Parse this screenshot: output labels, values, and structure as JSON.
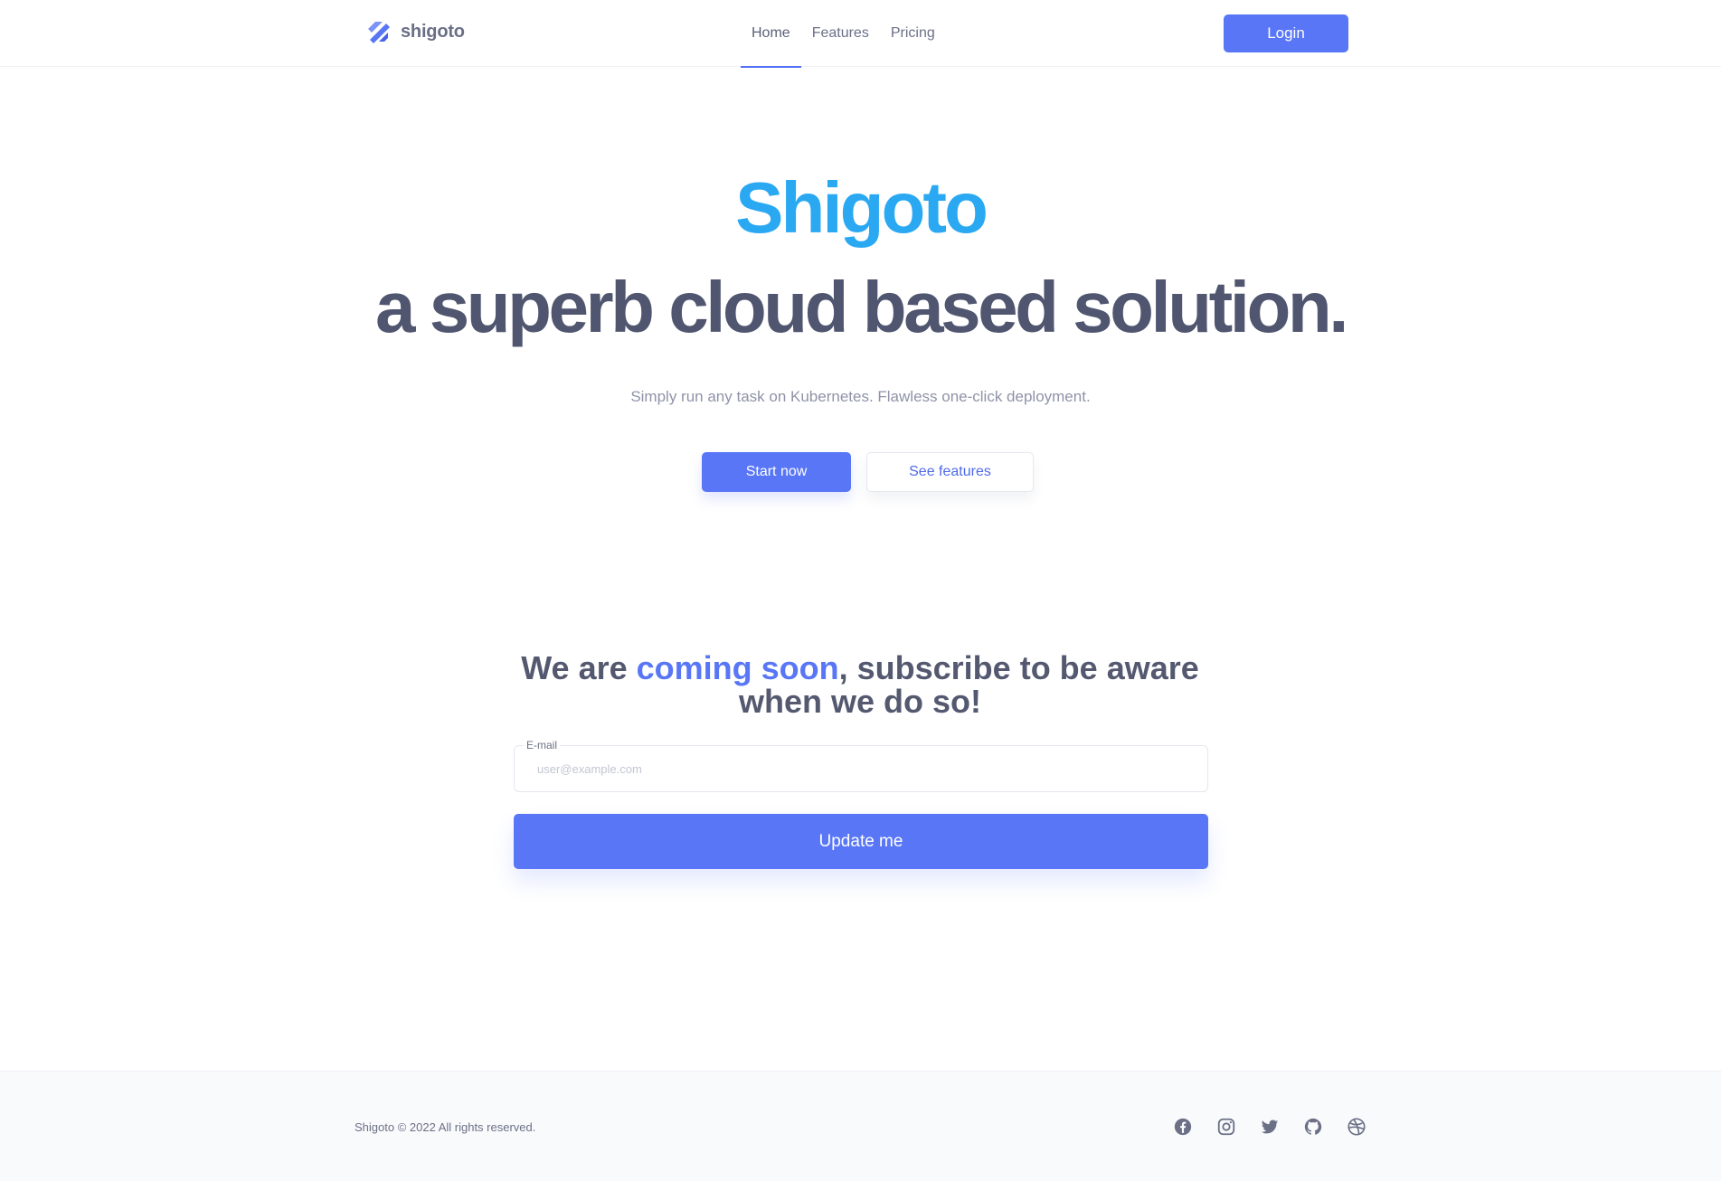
{
  "brand": {
    "name": "shigoto",
    "color": "#5876f6"
  },
  "nav": {
    "items": [
      {
        "label": "Home",
        "active": true
      },
      {
        "label": "Features",
        "active": false
      },
      {
        "label": "Pricing",
        "active": false
      }
    ],
    "login_label": "Login"
  },
  "hero": {
    "brand_line": "Shigoto",
    "title": "a superb cloud based solution.",
    "subtitle": "Simply run any task on Kubernetes. Flawless one-click deployment.",
    "primary_cta": "Start now",
    "secondary_cta": "See features"
  },
  "subscribe": {
    "heading_before": "We are ",
    "heading_accent": "coming soon",
    "heading_after": ", subscribe to be aware when we do so!",
    "email_label": "E-mail",
    "email_placeholder": "user@example.com",
    "email_value": "",
    "submit_label": "Update me"
  },
  "footer": {
    "copyright": "Shigoto © 2022 All rights reserved.",
    "socials": [
      "facebook-icon",
      "instagram-icon",
      "twitter-icon",
      "github-icon",
      "dribbble-icon"
    ]
  },
  "colors": {
    "accent": "#5876f6",
    "hero_brand": "#2aa8f2",
    "heading": "#515670",
    "muted": "#8e93a8"
  }
}
